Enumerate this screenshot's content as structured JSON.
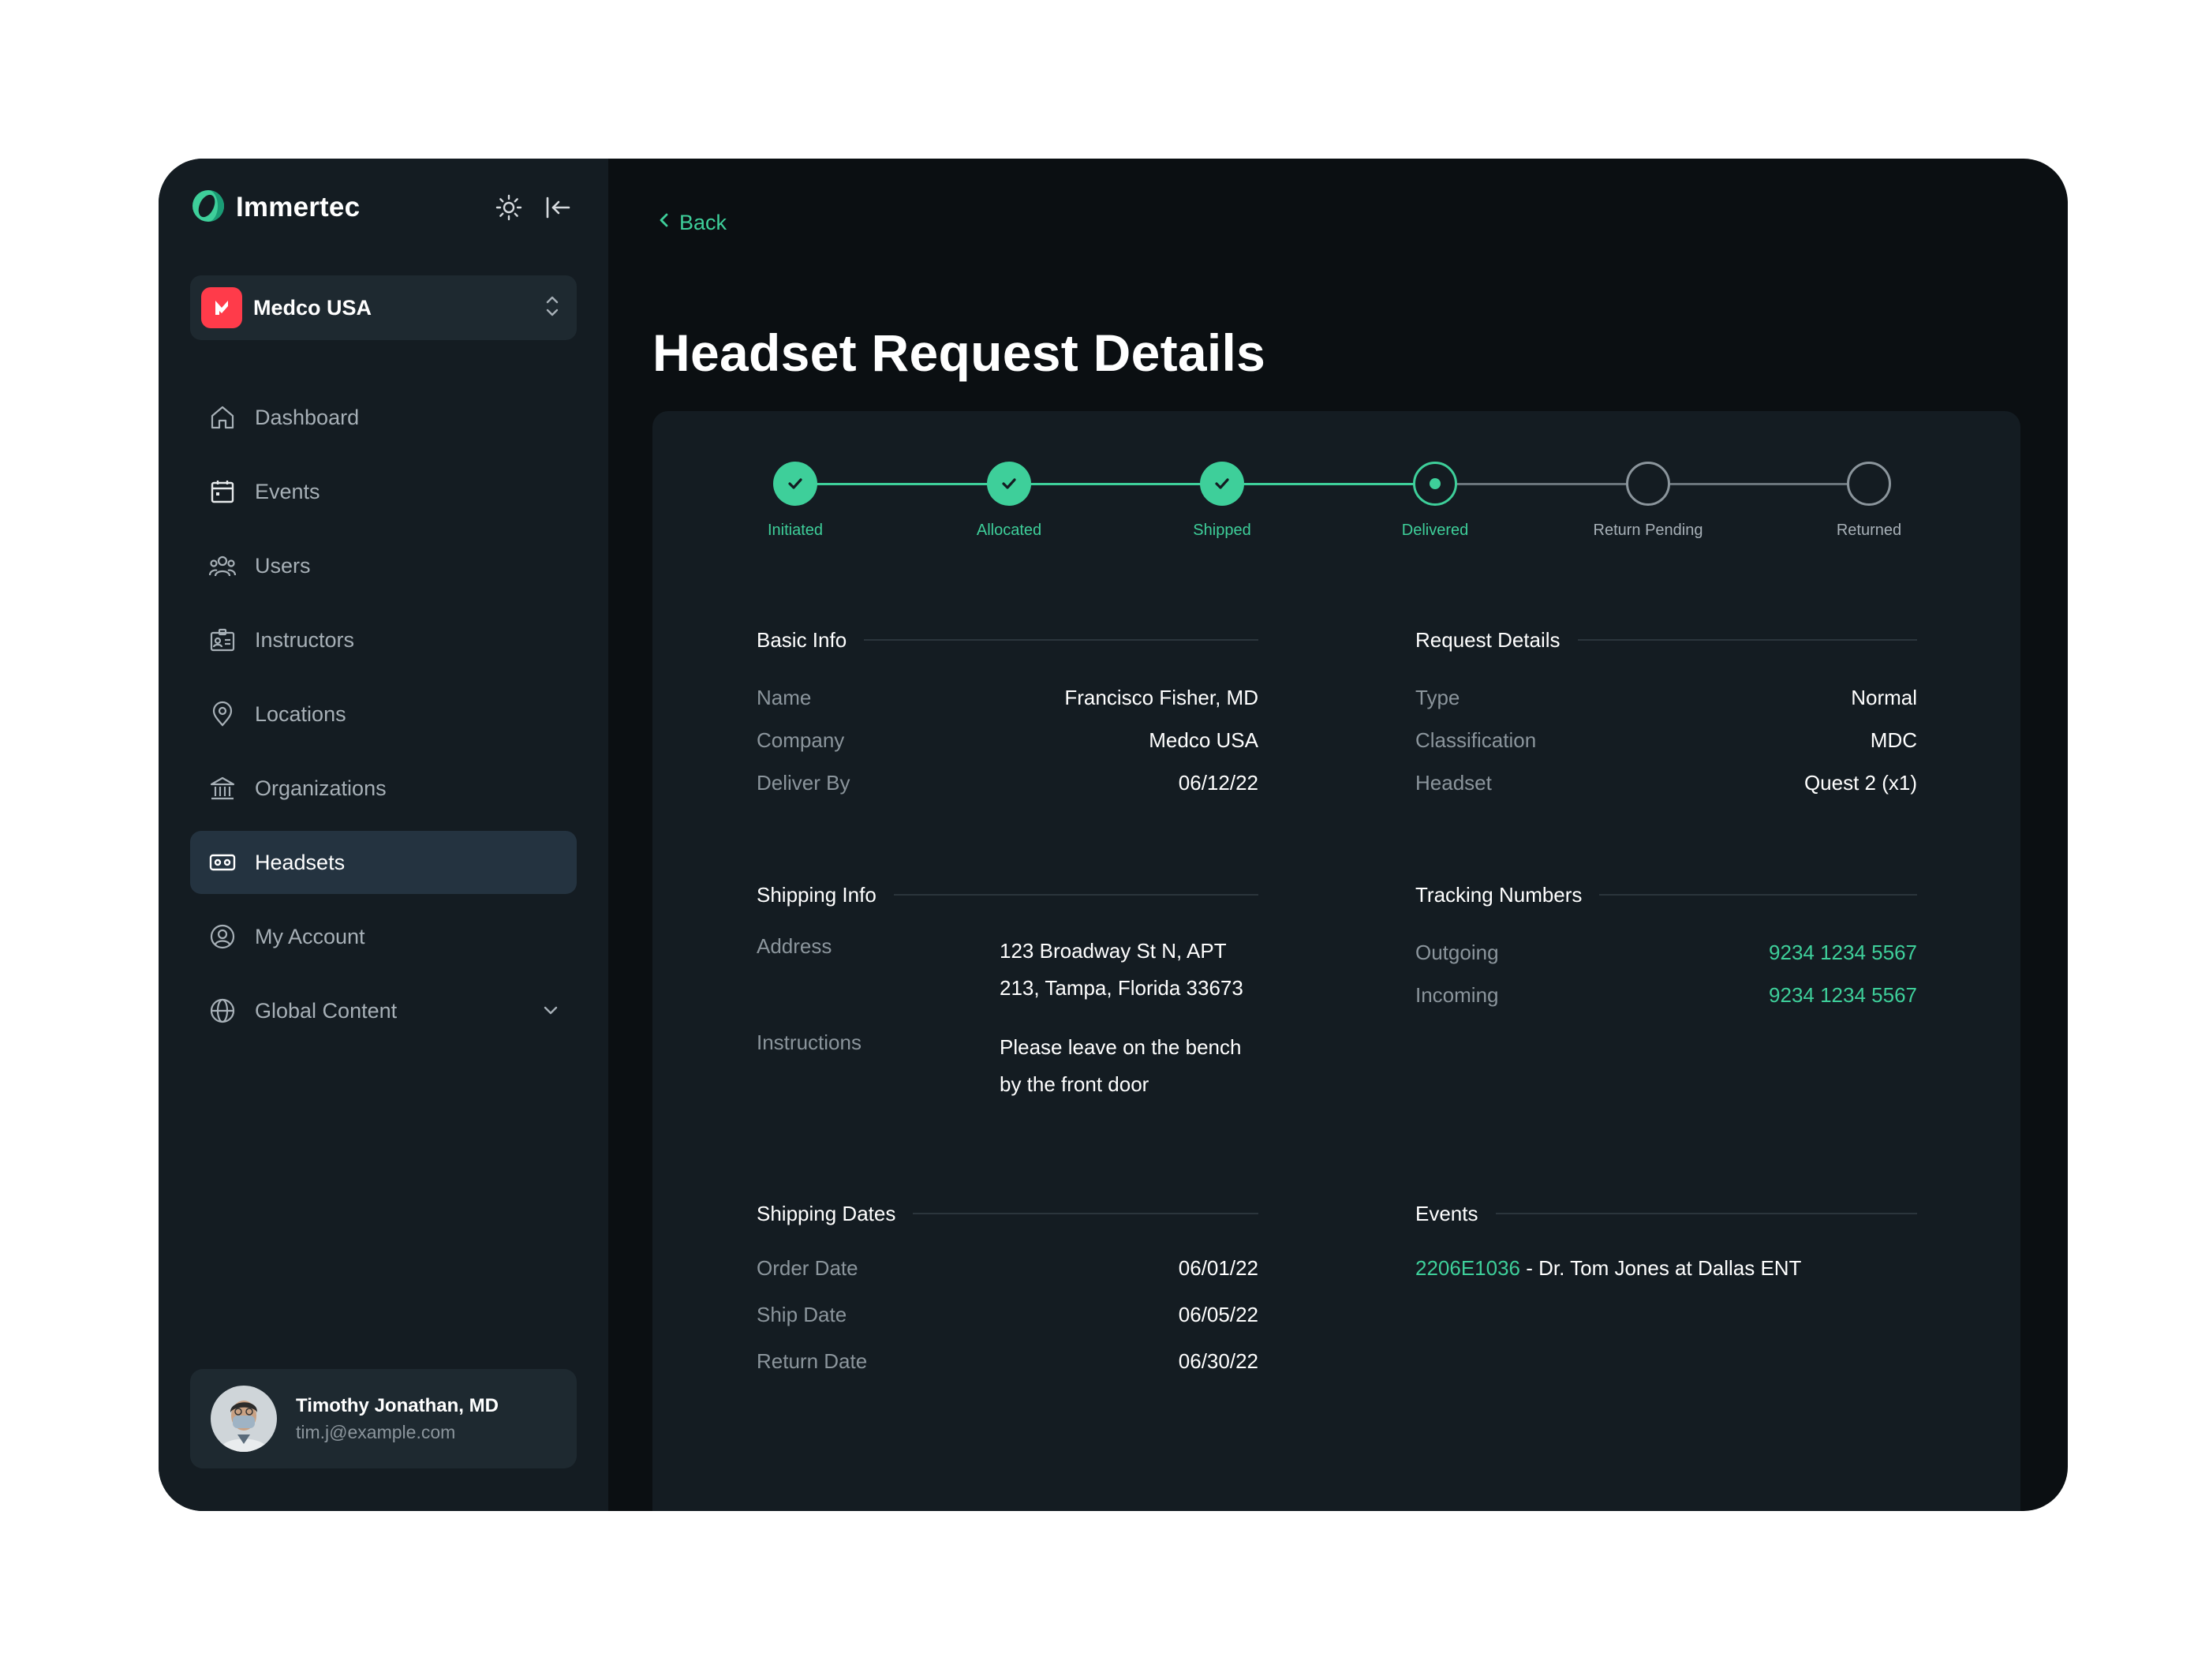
{
  "brand": {
    "name": "Immertec"
  },
  "org_switcher": {
    "name": "Medco USA"
  },
  "nav": {
    "items": [
      {
        "label": "Dashboard"
      },
      {
        "label": "Events"
      },
      {
        "label": "Users"
      },
      {
        "label": "Instructors"
      },
      {
        "label": "Locations"
      },
      {
        "label": "Organizations"
      },
      {
        "label": "Headsets"
      },
      {
        "label": "My Account"
      },
      {
        "label": "Global Content"
      }
    ],
    "active": "Headsets"
  },
  "user": {
    "name": "Timothy Jonathan, MD",
    "email": "tim.j@example.com"
  },
  "back": {
    "label": "Back"
  },
  "page": {
    "title": "Headset Request Details"
  },
  "stepper": {
    "steps": [
      {
        "label": "Initiated",
        "state": "done"
      },
      {
        "label": "Allocated",
        "state": "done"
      },
      {
        "label": "Shipped",
        "state": "done"
      },
      {
        "label": "Delivered",
        "state": "current"
      },
      {
        "label": "Return Pending",
        "state": "pending"
      },
      {
        "label": "Returned",
        "state": "pending"
      }
    ]
  },
  "basic_info": {
    "title": "Basic Info",
    "rows": [
      {
        "label": "Name",
        "value": "Francisco Fisher, MD"
      },
      {
        "label": "Company",
        "value": "Medco USA"
      },
      {
        "label": "Deliver By",
        "value": "06/12/22"
      }
    ]
  },
  "request_details": {
    "title": "Request Details",
    "rows": [
      {
        "label": "Type",
        "value": "Normal"
      },
      {
        "label": "Classification",
        "value": "MDC"
      },
      {
        "label": "Headset",
        "value": "Quest 2 (x1)"
      }
    ]
  },
  "shipping_info": {
    "title": "Shipping Info",
    "address_label": "Address",
    "address_line1": "123 Broadway St N, APT",
    "address_line2": "213, Tampa, Florida 33673",
    "instructions_label": "Instructions",
    "instructions_line1": "Please leave on the bench",
    "instructions_line2": "by the front door"
  },
  "tracking": {
    "title": "Tracking Numbers",
    "rows": [
      {
        "label": "Outgoing",
        "value": "9234 1234 5567"
      },
      {
        "label": "Incoming",
        "value": "9234 1234 5567"
      }
    ]
  },
  "shipping_dates": {
    "title": "Shipping Dates",
    "rows": [
      {
        "label": "Order Date",
        "value": "06/01/22"
      },
      {
        "label": "Ship Date",
        "value": "06/05/22"
      },
      {
        "label": "Return Date",
        "value": "06/30/22"
      }
    ]
  },
  "events": {
    "title": "Events",
    "event_id": "2206E1036",
    "event_desc": " - Dr. Tom Jones at Dallas ENT"
  },
  "colors": {
    "accent": "#3ecf9a",
    "background": "#0b0f12",
    "sidebar": "#141c22",
    "org_logo": "#ff3b4a"
  }
}
